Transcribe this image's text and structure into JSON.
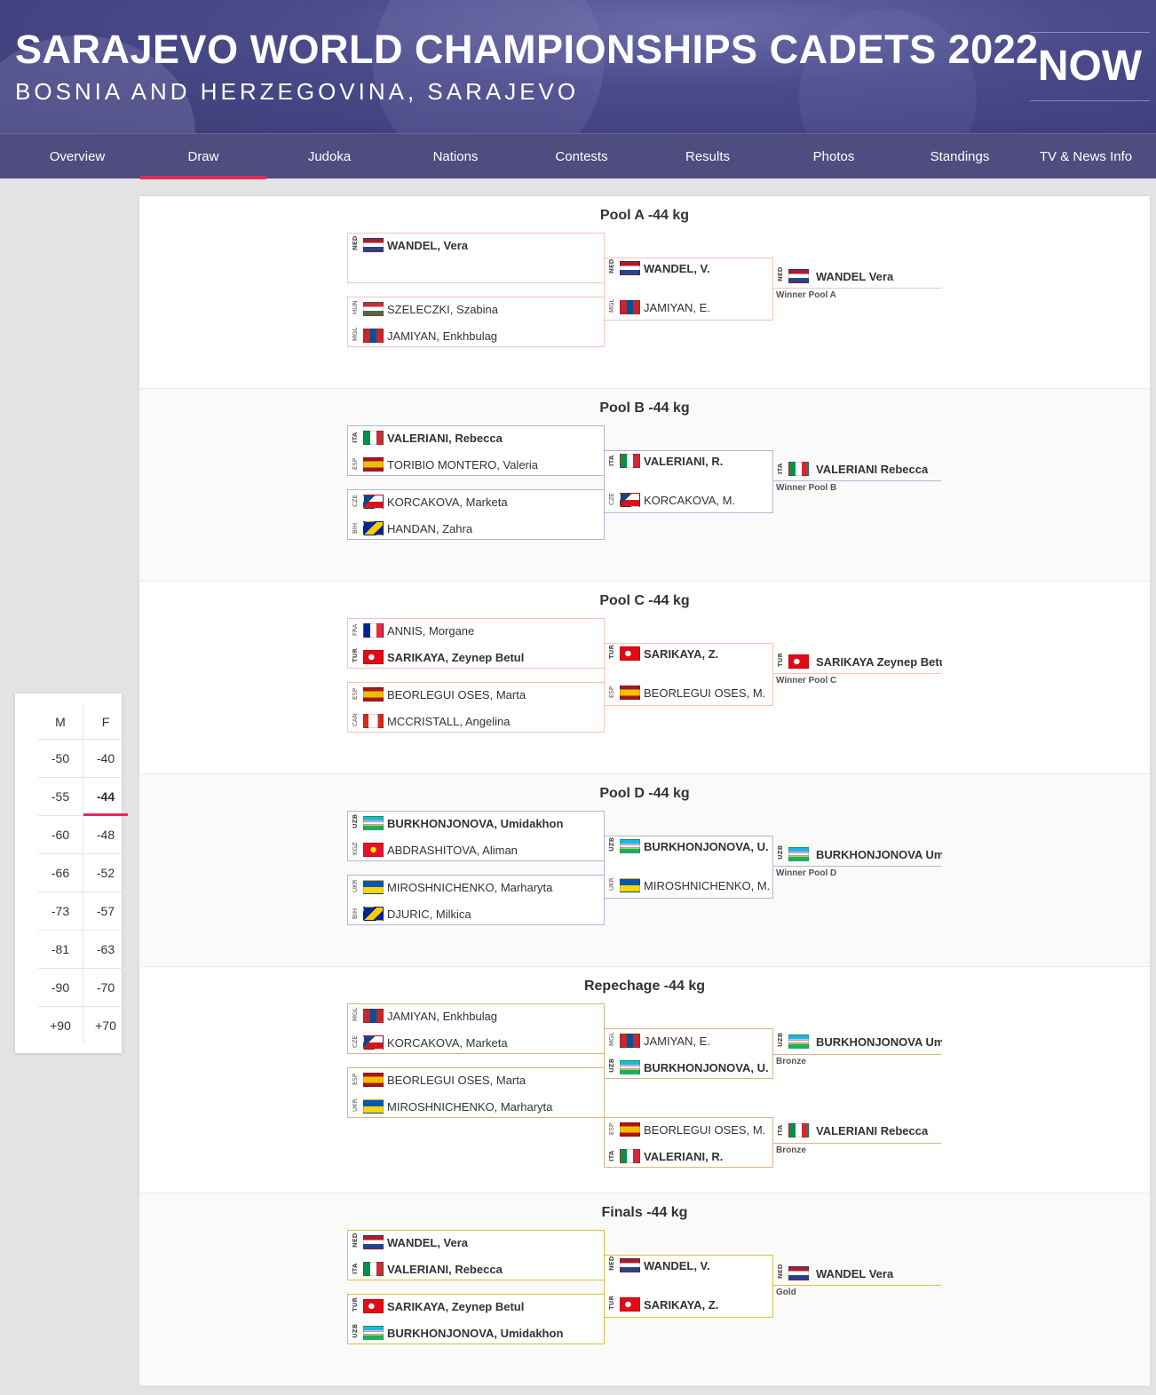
{
  "header": {
    "title": "SARAJEVO WORLD CHAMPIONSHIPS CADETS 2022",
    "subtitle": "BOSNIA AND HERZEGOVINA, SARAJEVO",
    "badge": "NOW"
  },
  "nav": {
    "items": [
      "Overview",
      "Draw",
      "Judoka",
      "Nations",
      "Contests",
      "Results",
      "Photos",
      "Standings",
      "TV & News Info"
    ],
    "active": "Draw"
  },
  "weights": {
    "headers": [
      "M",
      "F"
    ],
    "male": [
      "-50",
      "-55",
      "-60",
      "-66",
      "-73",
      "-81",
      "-90",
      "+90"
    ],
    "female": [
      "-40",
      "-44",
      "-48",
      "-52",
      "-57",
      "-63",
      "-70",
      "+70"
    ],
    "active": "-44"
  },
  "colors": {
    "pool_a": "#f4c5b4",
    "pool_b": "#b5b3dd",
    "pool_c": "#f4c5b4",
    "pool_d": "#b5b3dd",
    "repechage": "#d8b48a",
    "finals": "#d9c23e",
    "accent": "#e6285a"
  },
  "sections": [
    {
      "title": "Pool A -44 kg",
      "round1": [
        [
          {
            "nat": "NED",
            "name": "WANDEL, Vera",
            "win": true
          }
        ],
        [
          {
            "nat": "HUN",
            "name": "SZELECZKI, Szabina",
            "win": false
          },
          {
            "nat": "MGL",
            "name": "JAMIYAN, Enkhbulag",
            "win": false
          }
        ]
      ],
      "round2": [
        {
          "nat": "NED",
          "name": "WANDEL, V.",
          "win": true
        },
        {
          "nat": "MGL",
          "name": "JAMIYAN, E.",
          "win": false
        }
      ],
      "final": {
        "nat": "NED",
        "name": "WANDEL Vera",
        "label": "Winner Pool A"
      }
    },
    {
      "title": "Pool B -44 kg",
      "round1": [
        [
          {
            "nat": "ITA",
            "name": "VALERIANI, Rebecca",
            "win": true
          },
          {
            "nat": "ESP",
            "name": "TORIBIO MONTERO, Valeria",
            "win": false
          }
        ],
        [
          {
            "nat": "CZE",
            "name": "KORCAKOVA, Marketa",
            "win": false
          },
          {
            "nat": "BIH",
            "name": "HANDAN, Zahra",
            "win": false
          }
        ]
      ],
      "round2": [
        {
          "nat": "ITA",
          "name": "VALERIANI, R.",
          "win": true
        },
        {
          "nat": "CZE",
          "name": "KORCAKOVA, M.",
          "win": false
        }
      ],
      "final": {
        "nat": "ITA",
        "name": "VALERIANI Rebecca",
        "label": "Winner Pool B"
      }
    },
    {
      "title": "Pool C -44 kg",
      "round1": [
        [
          {
            "nat": "FRA",
            "name": "ANNIS, Morgane",
            "win": false
          },
          {
            "nat": "TUR",
            "name": "SARIKAYA, Zeynep Betul",
            "win": true
          }
        ],
        [
          {
            "nat": "ESP",
            "name": "BEORLEGUI OSES, Marta",
            "win": false
          },
          {
            "nat": "CAN",
            "name": "MCCRISTALL, Angelina",
            "win": false
          }
        ]
      ],
      "round2": [
        {
          "nat": "TUR",
          "name": "SARIKAYA, Z.",
          "win": true
        },
        {
          "nat": "ESP",
          "name": "BEORLEGUI OSES, M.",
          "win": false
        }
      ],
      "final": {
        "nat": "TUR",
        "name": "SARIKAYA Zeynep Betu",
        "label": "Winner Pool C"
      }
    },
    {
      "title": "Pool D -44 kg",
      "round1": [
        [
          {
            "nat": "UZB",
            "name": "BURKHONJONOVA, Umidakhon",
            "win": true
          },
          {
            "nat": "KGZ",
            "name": "ABDRASHITOVA, Aliman",
            "win": false
          }
        ],
        [
          {
            "nat": "UKR",
            "name": "MIROSHNICHENKO, Marharyta",
            "win": false
          },
          {
            "nat": "BIH",
            "name": "DJURIC, Milkica",
            "win": false
          }
        ]
      ],
      "round2": [
        {
          "nat": "UZB",
          "name": "BURKHONJONOVA, U.",
          "win": true
        },
        {
          "nat": "UKR",
          "name": "MIROSHNICHENKO, M.",
          "win": false
        }
      ],
      "final": {
        "nat": "UZB",
        "name": "BURKHONJONOVA Um",
        "label": "Winner Pool D"
      }
    },
    {
      "title": "Repechage -44 kg",
      "round1": [
        [
          {
            "nat": "MGL",
            "name": "JAMIYAN, Enkhbulag",
            "win": false
          },
          {
            "nat": "CZE",
            "name": "KORCAKOVA, Marketa",
            "win": false
          }
        ],
        [
          {
            "nat": "ESP",
            "name": "BEORLEGUI OSES, Marta",
            "win": false
          },
          {
            "nat": "UKR",
            "name": "MIROSHNICHENKO, Marharyta",
            "win": false
          }
        ]
      ],
      "round2a": [
        {
          "nat": "MGL",
          "name": "JAMIYAN, E.",
          "win": false
        },
        {
          "nat": "UZB",
          "name": "BURKHONJONOVA, U.",
          "win": true
        }
      ],
      "final_a": {
        "nat": "UZB",
        "name": "BURKHONJONOVA Um",
        "label": "Bronze"
      },
      "round2b": [
        {
          "nat": "ESP",
          "name": "BEORLEGUI OSES, M.",
          "win": false
        },
        {
          "nat": "ITA",
          "name": "VALERIANI, R.",
          "win": true
        }
      ],
      "final_b": {
        "nat": "ITA",
        "name": "VALERIANI Rebecca",
        "label": "Bronze"
      }
    },
    {
      "title": "Finals -44 kg",
      "round1": [
        [
          {
            "nat": "NED",
            "name": "WANDEL, Vera",
            "win": true
          },
          {
            "nat": "ITA",
            "name": "VALERIANI, Rebecca",
            "win": true
          }
        ],
        [
          {
            "nat": "TUR",
            "name": "SARIKAYA, Zeynep Betul",
            "win": true
          },
          {
            "nat": "UZB",
            "name": "BURKHONJONOVA, Umidakhon",
            "win": true
          }
        ]
      ],
      "round2": [
        {
          "nat": "NED",
          "name": "WANDEL, V.",
          "win": true
        },
        {
          "nat": "TUR",
          "name": "SARIKAYA, Z.",
          "win": true
        }
      ],
      "final": {
        "nat": "NED",
        "name": "WANDEL Vera",
        "label": "Gold"
      }
    }
  ]
}
